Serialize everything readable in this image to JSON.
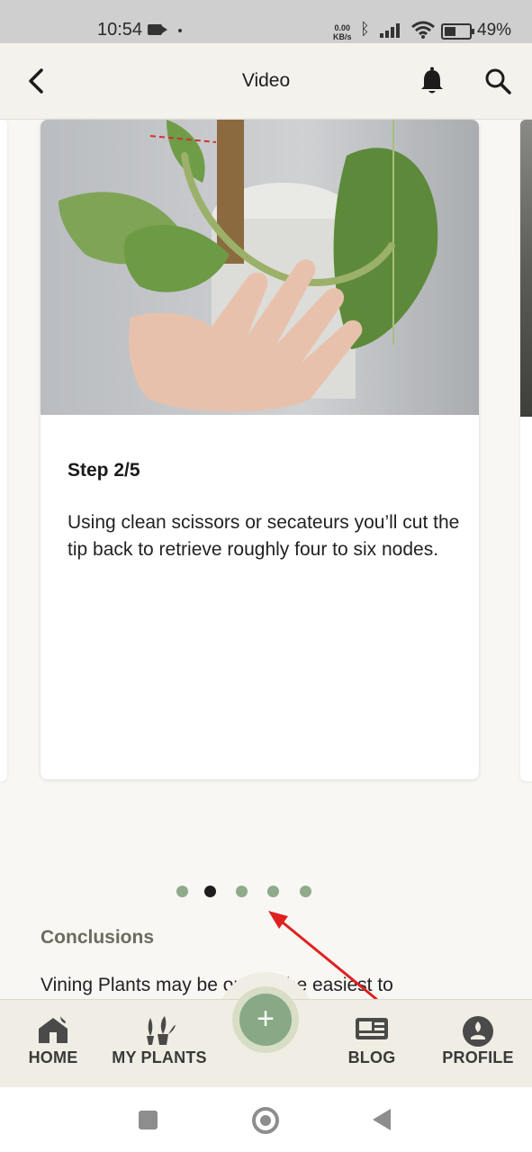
{
  "status_bar": {
    "time": "10:54",
    "speed_value": "0.00",
    "speed_unit": "KB/s",
    "battery_pct": "49%"
  },
  "header": {
    "title": "Video",
    "back_icon": "back-arrow-icon",
    "bell_icon": "bell-icon",
    "search_icon": "search-icon"
  },
  "carousel": {
    "step_label": "Step 2/5",
    "step_text": "Using clean scissors or secateurs you’ll cut the tip back to retrieve roughly four to six nodes.",
    "total_steps": 5,
    "active_step": 2
  },
  "section": {
    "heading": "Conclusions",
    "paragraph_visible": "Vining Plants may be one of the easiest to"
  },
  "bottom_nav": {
    "items": [
      {
        "label": "HOME",
        "icon": "home-icon"
      },
      {
        "label": "MY PLANTS",
        "icon": "plants-icon"
      },
      {
        "label": "BLOG",
        "icon": "blog-icon"
      },
      {
        "label": "PROFILE",
        "icon": "profile-icon"
      }
    ],
    "fab_symbol": "+"
  },
  "colors": {
    "accent_green": "#87a985",
    "dot_inactive": "#8faa8c",
    "dot_active": "#1e1e1e",
    "annotation_red": "#e02020"
  }
}
